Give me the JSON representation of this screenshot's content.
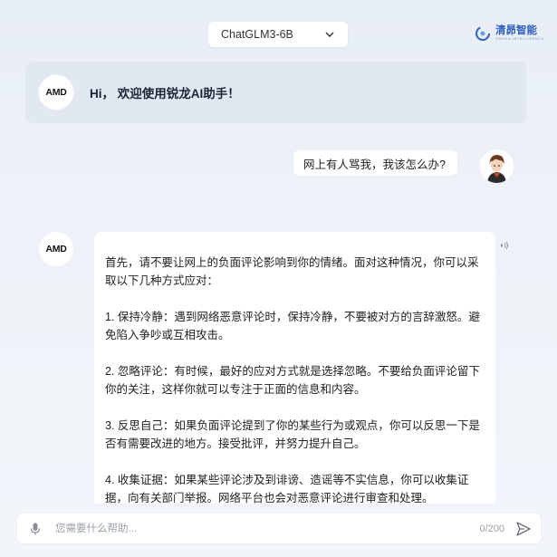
{
  "model_selector": {
    "selected": "ChatGLM3-6B"
  },
  "brand": {
    "name": "清昴智能",
    "subtitle": "ORIGIN INTELLIGENCE"
  },
  "welcome": {
    "avatar": "AMD",
    "text": "Hi， 欢迎使用锐龙AI助手！"
  },
  "conversation": {
    "user_message": "网上有人骂我，我该怎么办?",
    "bot_avatar": "AMD",
    "bot_paragraphs": [
      " 首先，请不要让网上的负面评论影响到你的情绪。面对这种情况，你可以采取以下几种方式应对：",
      "1. 保持冷静：遇到网络恶意评论时，保持冷静，不要被对方的言辞激怒。避免陷入争吵或互相攻击。",
      "2. 忽略评论：有时候，最好的应对方式就是选择忽略。不要给负面评论留下你的关注，这样你就可以专注于正面的信息和内容。",
      "3. 反思自己：如果负面评论提到了你的某些行为或观点，你可以反思一下是否有需要改进的地方。接受批评，并努力提升自己。",
      "4. 收集证据：如果某些评论涉及到诽谤、造谣等不实信息，你可以收集证据，向有关部门举报。网络平台也会对恶意评论进行审查和处理。"
    ]
  },
  "input": {
    "placeholder": "您需要什么帮助...",
    "value": "",
    "counter": "0/200"
  },
  "icons": {
    "dropdown": "chevron-down-icon",
    "brand": "brand-logo-icon",
    "speaker": "speaker-icon",
    "mic": "microphone-icon",
    "send": "send-icon"
  },
  "colors": {
    "accent": "#2f5fbf",
    "background": "#eef2f8",
    "welcome_bg": "#e1e8f2"
  }
}
